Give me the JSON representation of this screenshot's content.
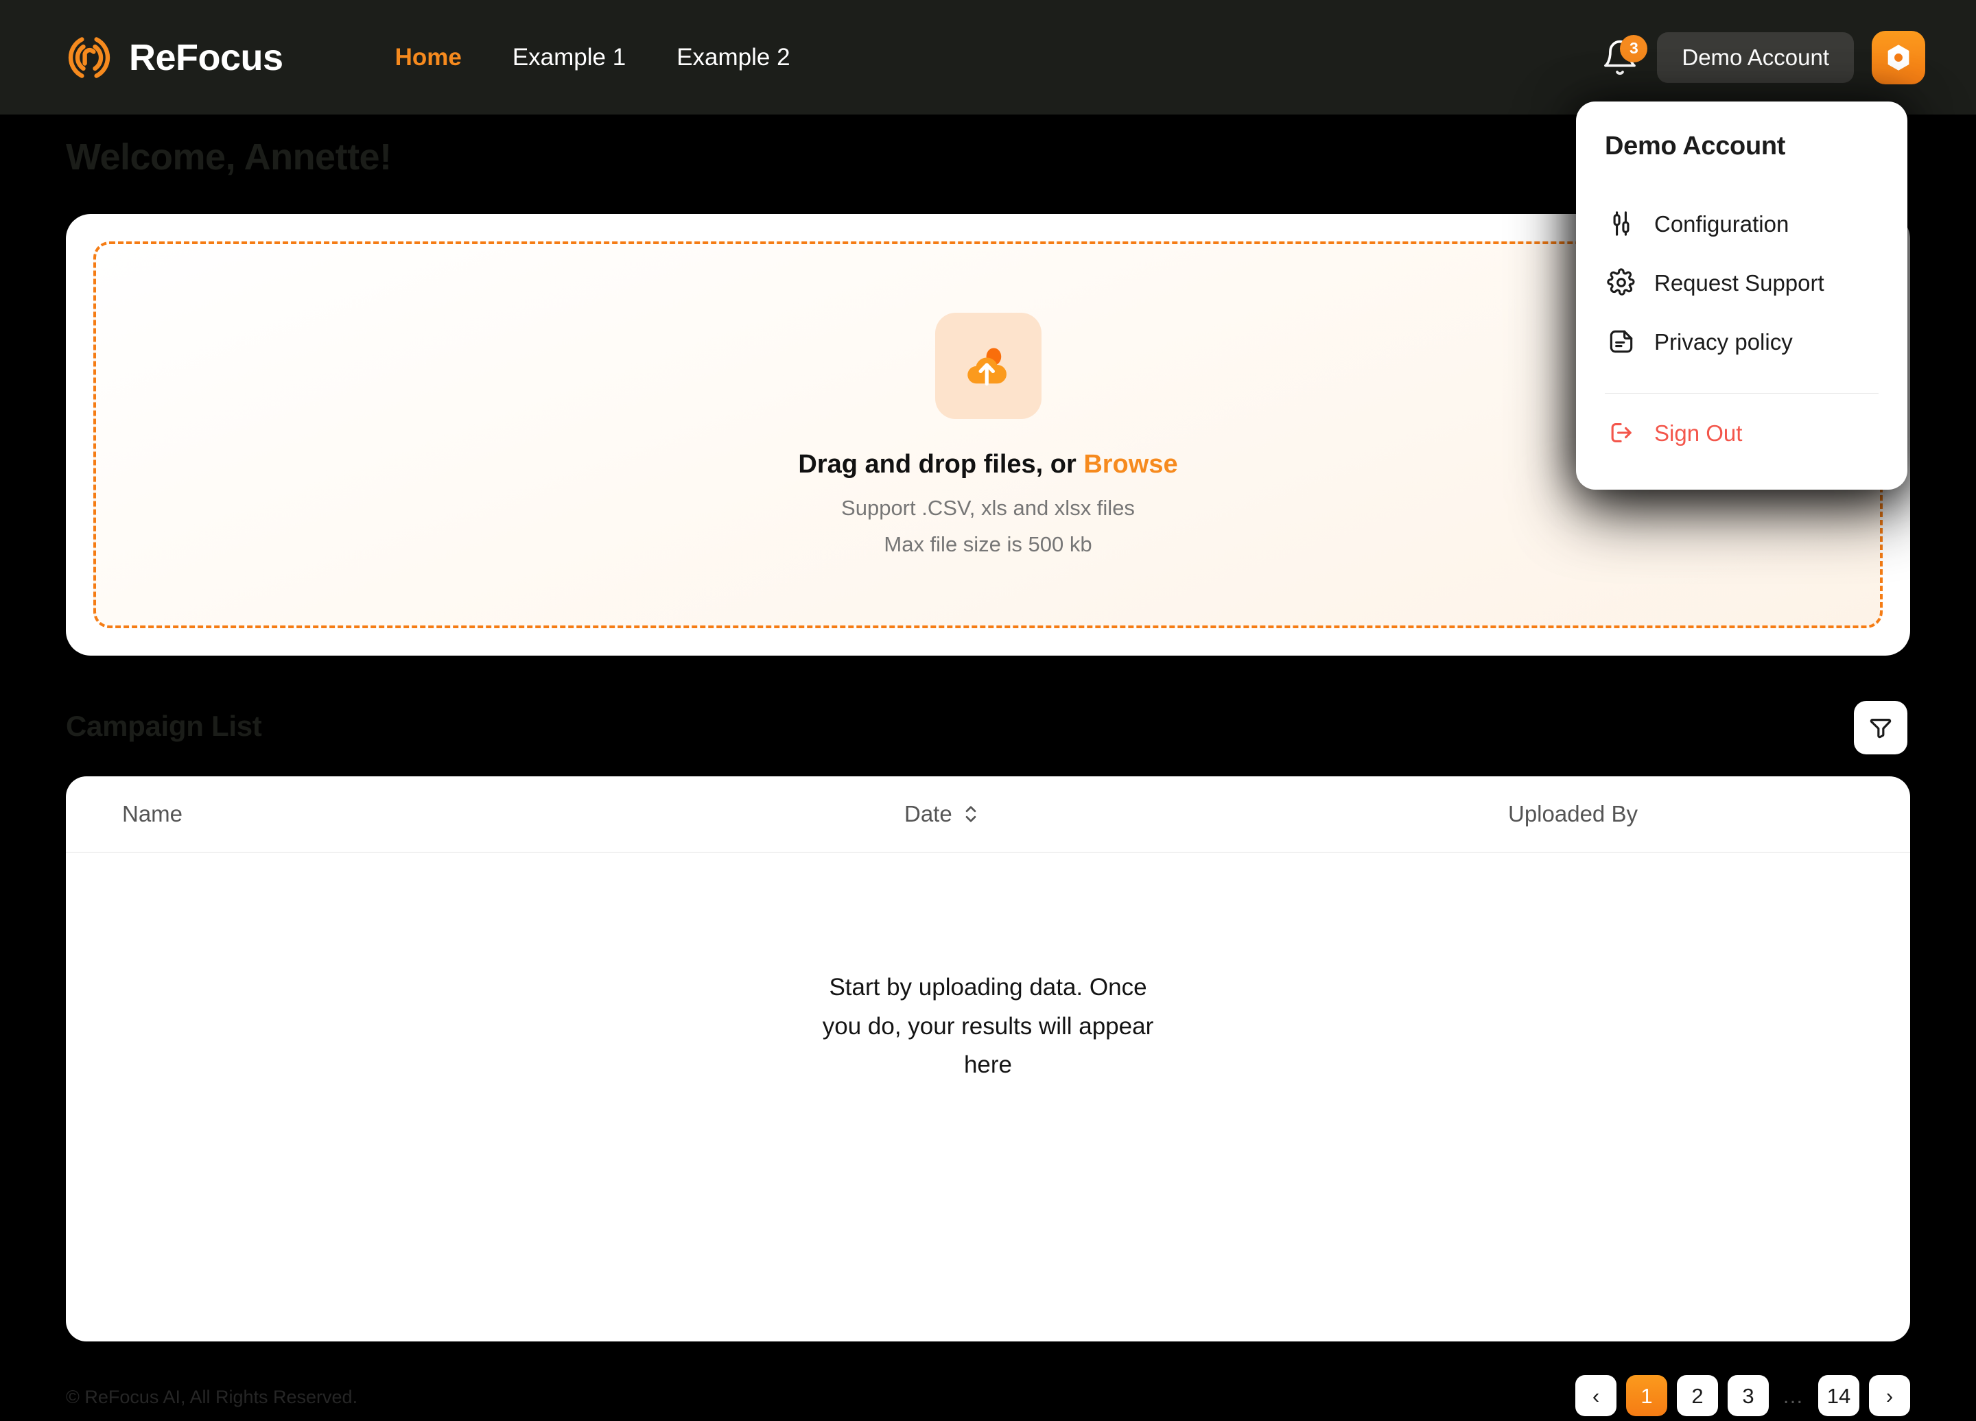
{
  "navbar": {
    "brand": "ReFocus",
    "links": [
      {
        "label": "Home",
        "active": true
      },
      {
        "label": "Example 1",
        "active": false
      },
      {
        "label": "Example 2",
        "active": false
      }
    ],
    "notification_count": "3",
    "account_label": "Demo Account"
  },
  "dropdown": {
    "title": "Demo Account",
    "items": [
      {
        "label": "Configuration",
        "icon": "sliders-icon"
      },
      {
        "label": "Request Support",
        "icon": "gear-icon"
      },
      {
        "label": "Privacy policy",
        "icon": "document-icon"
      }
    ],
    "sign_out": {
      "label": "Sign Out",
      "icon": "logout-icon"
    }
  },
  "page": {
    "welcome": "Welcome, Annette!",
    "section_title": "Campaign List",
    "footer": "© ReFocus AI, All Rights Reserved."
  },
  "upload": {
    "title_prefix": "Drag and drop files, or ",
    "browse_label": "Browse",
    "support_text": "Support .CSV, xls and xlsx files",
    "max_size_text": "Max file size is 500 kb",
    "icon": "cloud-upload-icon"
  },
  "table": {
    "columns": [
      "Name",
      "Date",
      "Uploaded By"
    ],
    "rows": [],
    "empty_message": "Start by uploading data. Once you do, your results will appear here"
  },
  "pagination": {
    "prev": "‹",
    "next": "›",
    "pages": [
      "1",
      "2",
      "3"
    ],
    "ellipsis": "…",
    "last": "14",
    "current": "1"
  },
  "colors": {
    "accent": "#F68A1E",
    "accent_dark": "#F57C14",
    "navbar_bg": "#1c1e1a",
    "page_bg": "#000000",
    "danger": "#F3564B"
  }
}
